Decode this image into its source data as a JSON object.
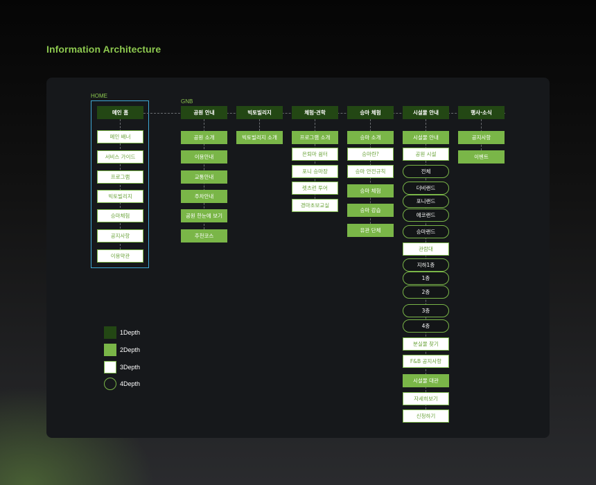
{
  "title": "Information Architecture",
  "home_label": "HOME",
  "gnb_label": "GNB",
  "home": {
    "title": "메인 홈",
    "items": [
      "메인 배너",
      "서비스 가이드",
      "프로그램",
      "빅토빌리지",
      "승마체험",
      "공지사항",
      "이용약관"
    ]
  },
  "columns": [
    {
      "title": "공원 안내",
      "items": [
        {
          "label": "공원 소개",
          "depth": 2
        },
        {
          "label": "이용안내",
          "depth": 2
        },
        {
          "label": "교통안내",
          "depth": 2
        },
        {
          "label": "주차안내",
          "depth": 2
        },
        {
          "label": "공원 한눈에 보기",
          "depth": 2
        },
        {
          "label": "추천코스",
          "depth": 2
        }
      ]
    },
    {
      "title": "빅토빌리지",
      "items": [
        {
          "label": "빅토빌리지 소개",
          "depth": 2
        }
      ]
    },
    {
      "title": "체험·견학",
      "items": [
        {
          "label": "프로그램 소개",
          "depth": 2
        },
        {
          "label": "은퇴마 쉼터",
          "depth": 3
        },
        {
          "label": "포니 승마장",
          "depth": 3
        },
        {
          "label": "렛츠런 투어",
          "depth": 3
        },
        {
          "label": "경마초보교실",
          "depth": 3
        }
      ]
    },
    {
      "title": "승마 체험",
      "items": [
        {
          "label": "승마 소개",
          "depth": 2
        },
        {
          "label": "승마란?",
          "depth": 3
        },
        {
          "label": "승마 안전규칙",
          "depth": 3
        },
        {
          "label": "승마 체험",
          "depth": 2
        },
        {
          "label": "승마 강습",
          "depth": 2
        },
        {
          "label": "유관 단체",
          "depth": 2
        }
      ]
    },
    {
      "title": "시설물 안내",
      "items": [
        {
          "label": "시설물 안내",
          "depth": 2
        },
        {
          "label": "공원 시설",
          "depth": 3
        },
        {
          "label": "전체",
          "depth": 4
        },
        {
          "label": "더비랜드",
          "depth": 4
        },
        {
          "label": "포니랜드",
          "depth": 4
        },
        {
          "label": "에코랜드",
          "depth": 4
        },
        {
          "label": "승마랜드",
          "depth": 4
        },
        {
          "label": "관람대",
          "depth": 3
        },
        {
          "label": "지하1층",
          "depth": 4
        },
        {
          "label": "1층",
          "depth": 4
        },
        {
          "label": "2층",
          "depth": 4
        },
        {
          "label": "3층",
          "depth": 4
        },
        {
          "label": "4층",
          "depth": 4
        },
        {
          "label": "분실물 찾기",
          "depth": 3
        },
        {
          "label": "F&B 공지사항",
          "depth": 3
        },
        {
          "label": "시설물 대관",
          "depth": 2
        },
        {
          "label": "자세히보기",
          "depth": 3
        },
        {
          "label": "신청하기",
          "depth": 3
        }
      ]
    },
    {
      "title": "행사·소식",
      "items": [
        {
          "label": "공지사항",
          "depth": 2
        },
        {
          "label": "이벤트",
          "depth": 2
        }
      ]
    }
  ],
  "legend": [
    {
      "label": "1Depth",
      "depth": 1
    },
    {
      "label": "2Depth",
      "depth": 2
    },
    {
      "label": "3Depth",
      "depth": 3
    },
    {
      "label": "4Depth",
      "depth": 4
    }
  ]
}
